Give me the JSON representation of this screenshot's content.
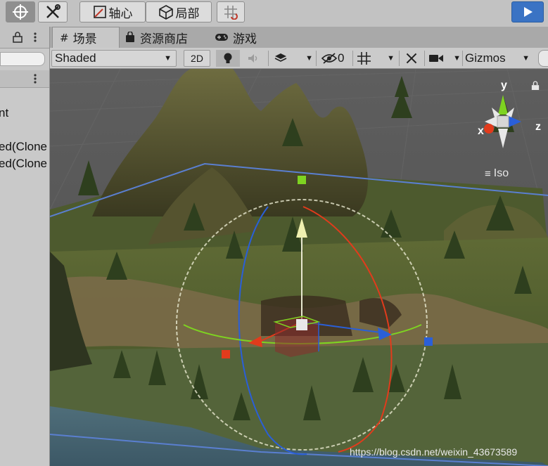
{
  "toolbar": {
    "pivot_label": "轴心",
    "local_label": "局部"
  },
  "hierarchy": {
    "items": [
      "nt",
      "ed(Clone",
      "ed(Clone"
    ]
  },
  "tabs": [
    {
      "label": "场景",
      "icon": "grid-icon"
    },
    {
      "label": "资源商店",
      "icon": "store-bag-icon"
    },
    {
      "label": "游戏",
      "icon": "gamepad-icon"
    }
  ],
  "scene_toolbar": {
    "shading_mode": "Shaded",
    "mode_2d": "2D",
    "hidden_count": "0",
    "gizmos_label": "Gizmos"
  },
  "orientation_gizmo": {
    "y": "y",
    "x": "x",
    "z": "z",
    "projection": "Iso"
  },
  "watermark": "https://blog.csdn.net/weixin_43673589",
  "colors": {
    "play_button": "#3a73c4",
    "axis_x": "#e23b1c",
    "axis_y": "#7ed321",
    "axis_z": "#2a5fd8",
    "terrain": "#6b6a3a"
  }
}
